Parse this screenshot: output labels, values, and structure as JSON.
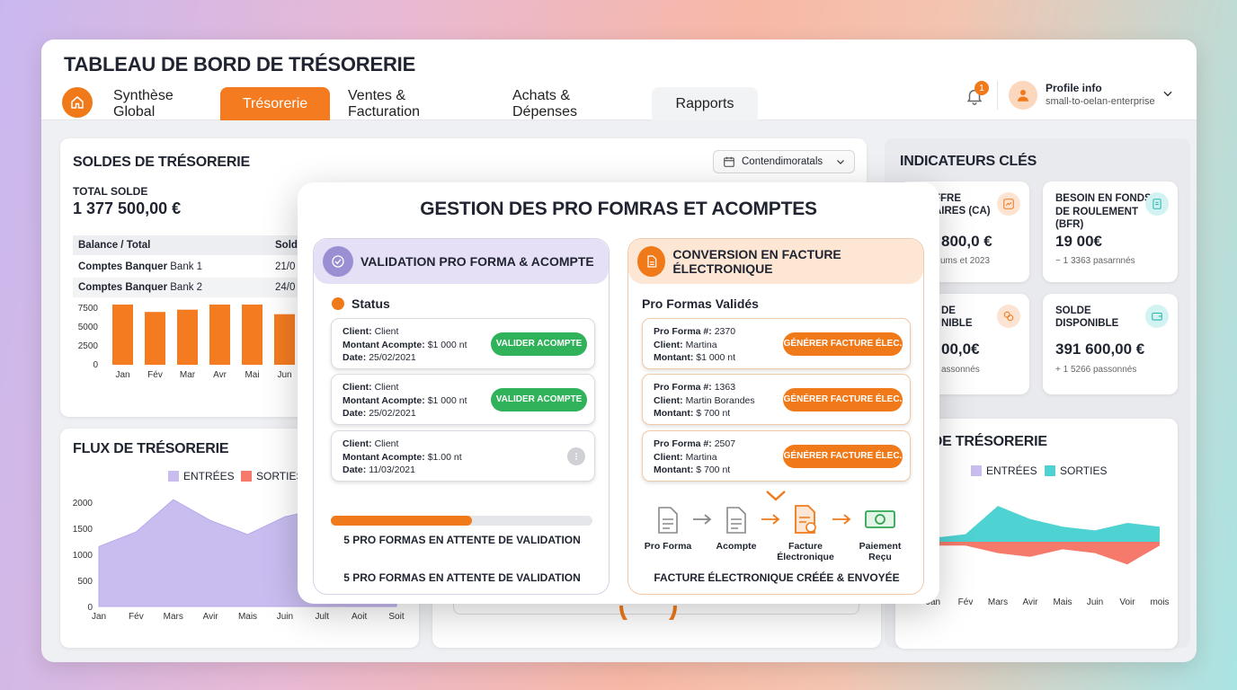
{
  "header": {
    "title": "TABLEAU DE BORD DE TRÉSORERIE",
    "tabs": [
      "Synthèse Global",
      "Trésorerie",
      "Ventes & Facturation",
      "Achats & Dépenses",
      "Rapports"
    ],
    "active_tab": "Trésorerie",
    "notification_count": "1",
    "profile_name": "Profile info",
    "profile_id": "small-to-oelan-enterprise"
  },
  "soldes": {
    "title": "SOLDES DE TRÉSORERIE",
    "dropdown": "Contendimoratals",
    "total_label": "TOTAL SOLDE",
    "total_value": "1 377 500,00 €",
    "table_headers": [
      "Balance / Total",
      "Solde"
    ],
    "rows": [
      {
        "label_bold": "Comptes Banquer",
        "label": "Bank 1",
        "value": "21/0"
      },
      {
        "label_bold": "Comptes Banquer",
        "label": "Bank 2",
        "value": "24/0"
      }
    ]
  },
  "flux": {
    "title": "FLUX DE TRÉSORERIE",
    "legend_in": "ENTRÉES",
    "legend_out": "SORTIES"
  },
  "indicateurs": {
    "title": "INDICATEURS CLÉS",
    "cards": [
      {
        "title_l1": "FFRE",
        "title_l2": "AIRES (CA)",
        "value": "800,0 €",
        "sub": "ums et 2023"
      },
      {
        "title_l1": "BESOIN EN FONDS",
        "title_l2": "DE ROULEMENT",
        "title_l3": "(BFR)",
        "value": "19 00€",
        "sub": "− 1 3363 pasarnnés"
      },
      {
        "title_l1": "DE",
        "title_l2": "NIBLE",
        "value": "00,0€",
        "sub": "assonnés"
      },
      {
        "title_l1": "SOLDE",
        "title_l2": "DISPONIBLE",
        "value": "391 600,00 €",
        "sub": "+ 1 5266 passonnés"
      }
    ],
    "flux_title": "X DE TRÉSORERIE",
    "legend_in": "ENTRÉES",
    "legend_out": "SORTIES"
  },
  "modal": {
    "title": "GESTION DES PRO FOMRAS ET ACOMPTES",
    "left": {
      "header": "VALIDATION PRO FORMA & ACOMPTE",
      "status_label": "Status",
      "items": [
        {
          "client_label": "Client:",
          "client": "Client",
          "montant_label": "Montant Acompte:",
          "montant": "$1 000 nt",
          "date_label": "Date:",
          "date": "25/02/2021",
          "button": "VALIDER ACOMPTE"
        },
        {
          "client_label": "Client:",
          "client": "Client",
          "montant_label": "Montant Acompte:",
          "montant": "$1 000 nt",
          "date_label": "Date:",
          "date": "25/02/2021",
          "button": "VALIDER ACOMPTE"
        },
        {
          "client_label": "Client:",
          "client": "Client",
          "montant_label": "Montant Acompte:",
          "montant": "$1.00 nt",
          "date_label": "Date:",
          "date": "11/03/2021",
          "button": ""
        }
      ],
      "progress": 0.54,
      "pending_1": "5 PRO FORMAS EN ATTENTE DE VALIDATION",
      "pending_2": "5 PRO FORMAS EN ATTENTE DE VALIDATION"
    },
    "right": {
      "header": "CONVERSION EN FACTURE ÉLECTRONIQUE",
      "subtitle": "Pro Formas Validés",
      "items": [
        {
          "pf_label": "Pro Forma #:",
          "pf": "2370",
          "client_label": "Client:",
          "client": "Martina",
          "montant_label": "Montant:",
          "montant": "$1 000 nt",
          "button": "GÉNÉRER FACTURE ÉLEC."
        },
        {
          "pf_label": "Pro Forma #:",
          "pf": "1363",
          "client_label": "Client:",
          "client": "Martin Borandes",
          "montant_label": "Montant:",
          "montant": "$ 700 nt",
          "button": "GÉNÉRER FACTURE ÉLEC."
        },
        {
          "pf_label": "Pro Forma #:",
          "pf": "2507",
          "client_label": "Client:",
          "client": "Martina",
          "montant_label": "Montant:",
          "montant": "$ 700 nt",
          "button": "GÉNÉRER FACTURE ÉLEC."
        }
      ],
      "steps": [
        {
          "l1": "Pro Forma",
          "l2": ""
        },
        {
          "l1": "Acompte",
          "l2": ""
        },
        {
          "l1": "Facture",
          "l2": "Électronique"
        },
        {
          "l1": "Paiement",
          "l2": "Reçu"
        }
      ],
      "footer": "FACTURE ÉLECTRONIQUE CRÉÉE & ENVOYÉE"
    }
  },
  "colors": {
    "orange": "#f47b20",
    "green": "#2fb25a",
    "purple": "#c9bdf0",
    "teal": "#4fd2d2",
    "red": "#f57a6b"
  },
  "chart_data": [
    {
      "type": "bar",
      "categories": [
        "Jan",
        "Fév",
        "Mar",
        "Avr",
        "Mai",
        "Jun"
      ],
      "values": [
        8900,
        7000,
        7300,
        9200,
        8300,
        6700
      ],
      "ylim": [
        0,
        10000
      ],
      "yticks": [
        "0",
        "2500",
        "5000",
        "7500",
        "10000"
      ]
    },
    {
      "type": "area",
      "categories": [
        "Jan",
        "Fév",
        "Mars",
        "Avir",
        "Mais",
        "Juin",
        "Jult",
        "Aoit",
        "Soit"
      ],
      "series": [
        {
          "name": "ENTRÉES",
          "values": [
            1150,
            1430,
            2050,
            1650,
            1380,
            1720,
            1880,
            2000,
            2050
          ]
        }
      ],
      "ylim": [
        0,
        2500
      ],
      "yticks": [
        "0",
        "500",
        "1000",
        "1500",
        "2000",
        "2500"
      ]
    },
    {
      "type": "area",
      "categories": [
        "Jan",
        "Fév",
        "Mars",
        "Avir",
        "Mais",
        "Juin",
        "Voir",
        "mois"
      ],
      "ytick_min": "-100",
      "series": [
        {
          "name": "ENTRÉES",
          "values": [
            10,
            20,
            95,
            60,
            40,
            30,
            50,
            40
          ]
        },
        {
          "name": "SORTIES",
          "values": [
            -10,
            -10,
            -30,
            -40,
            -20,
            -30,
            -60,
            -10
          ]
        }
      ]
    }
  ]
}
